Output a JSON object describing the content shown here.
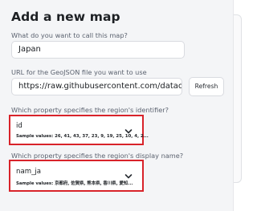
{
  "form": {
    "title": "Add a new map",
    "name_label": "What do you want to call this map?",
    "name_value": "Japan",
    "url_label": "URL for the GeoJSON file you want to use",
    "url_value": "https://raw.githubusercontent.com/dataofjapan/land",
    "refresh_label": "Refresh",
    "id_label": "Which property specifies the region's identifier?",
    "id_value": "id",
    "id_samples": "Sample values: 26, 41, 43, 37, 23, 9, 19, 25, 10, 4, 2...",
    "name_prop_label": "Which property specifies the region's display name?",
    "name_prop_value": "nam_ja",
    "name_prop_samples": "Sample values: 京都府, 佐賀県, 熊本県, 香川県, 愛知..."
  },
  "colors": {
    "highlight_border": "#d8232a",
    "panel_bg": "#f4f5f7"
  },
  "icons": {
    "dropdown": "chevron-down-icon"
  }
}
